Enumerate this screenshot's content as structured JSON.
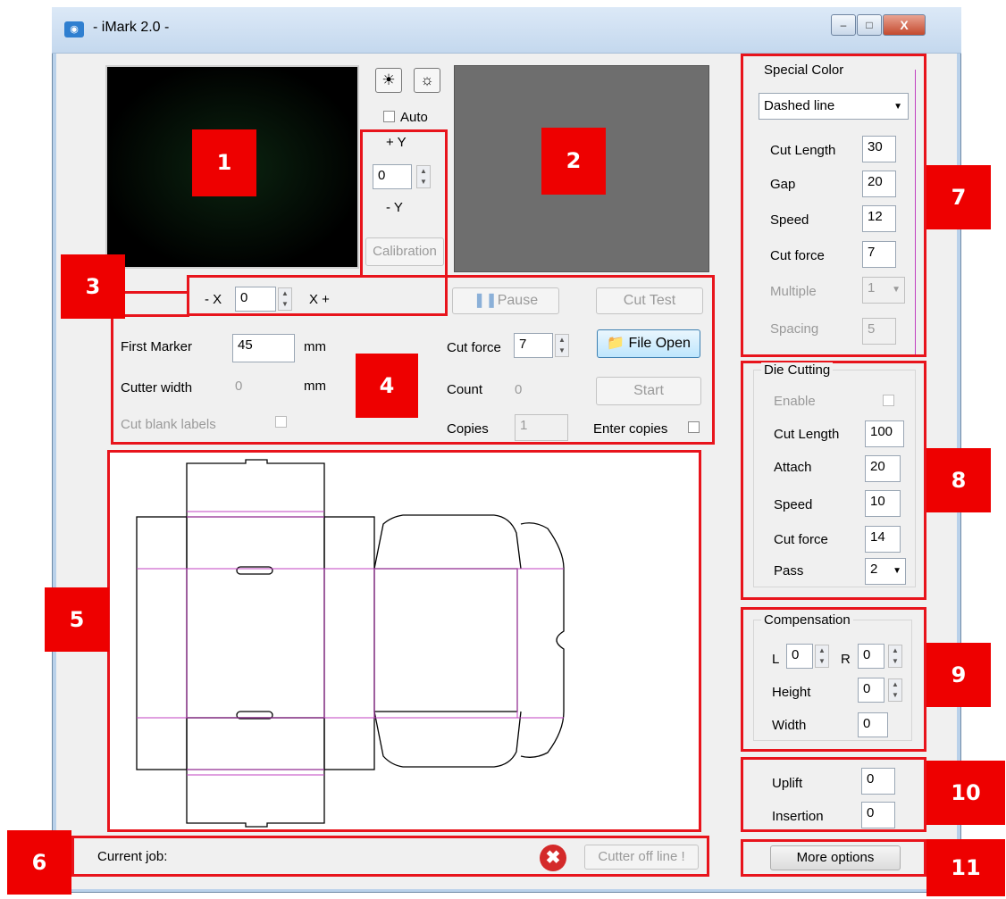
{
  "window": {
    "title": "- iMark 2.0 -",
    "minimize": "–",
    "maximize": "□",
    "close": "X"
  },
  "camera": {
    "auto_label": "Auto",
    "plus_y": "+ Y",
    "minus_y": "- Y",
    "y_value": "0",
    "calibration": "Calibration",
    "minus_x": "- X",
    "x_value": "0",
    "plus_x": "X +"
  },
  "controls": {
    "pause": "Pause",
    "cut_test": "Cut Test",
    "first_marker_label": "First Marker",
    "first_marker_value": "45",
    "mm1": "mm",
    "cutter_width_label": "Cutter width",
    "cutter_width_value": "0",
    "mm2": "mm",
    "cut_blank_labels": "Cut blank labels",
    "cut_force_label": "Cut force",
    "cut_force_value": "7",
    "file_open": "File Open",
    "count_label": "Count",
    "count_value": "0",
    "start": "Start",
    "copies_label": "Copies",
    "copies_value": "1",
    "enter_copies": "Enter copies"
  },
  "status": {
    "current_job_label": "Current job:",
    "cutter_status": "Cutter off line !"
  },
  "special_color": {
    "title": "Special Color",
    "mode": "Dashed line",
    "cut_length_label": "Cut Length",
    "cut_length": "30",
    "gap_label": "Gap",
    "gap": "20",
    "speed_label": "Speed",
    "speed": "12",
    "cut_force_label": "Cut force",
    "cut_force": "7",
    "multiple_label": "Multiple",
    "multiple": "1",
    "spacing_label": "Spacing",
    "spacing": "5"
  },
  "die_cutting": {
    "title": "Die Cutting",
    "enable_label": "Enable",
    "cut_length_label": "Cut Length",
    "cut_length": "100",
    "attach_label": "Attach",
    "attach": "20",
    "speed_label": "Speed",
    "speed": "10",
    "cut_force_label": "Cut force",
    "cut_force": "14",
    "pass_label": "Pass",
    "pass": "2"
  },
  "compensation": {
    "title": "Compensation",
    "l_label": "L",
    "l_value": "0",
    "r_label": "R",
    "r_value": "0",
    "height_label": "Height",
    "height": "0",
    "width_label": "Width",
    "width": "0"
  },
  "lift": {
    "uplift_label": "Uplift",
    "uplift": "0",
    "insertion_label": "Insertion",
    "insertion": "0"
  },
  "more_options": "More options",
  "badges": [
    "1",
    "2",
    "3",
    "4",
    "5",
    "6",
    "7",
    "8",
    "9",
    "10",
    "11"
  ],
  "colors": {
    "annotation_red": "#ee0000",
    "outline_red": "#e8141c",
    "fold_line": "#c040c0",
    "cut_line": "#000000"
  }
}
